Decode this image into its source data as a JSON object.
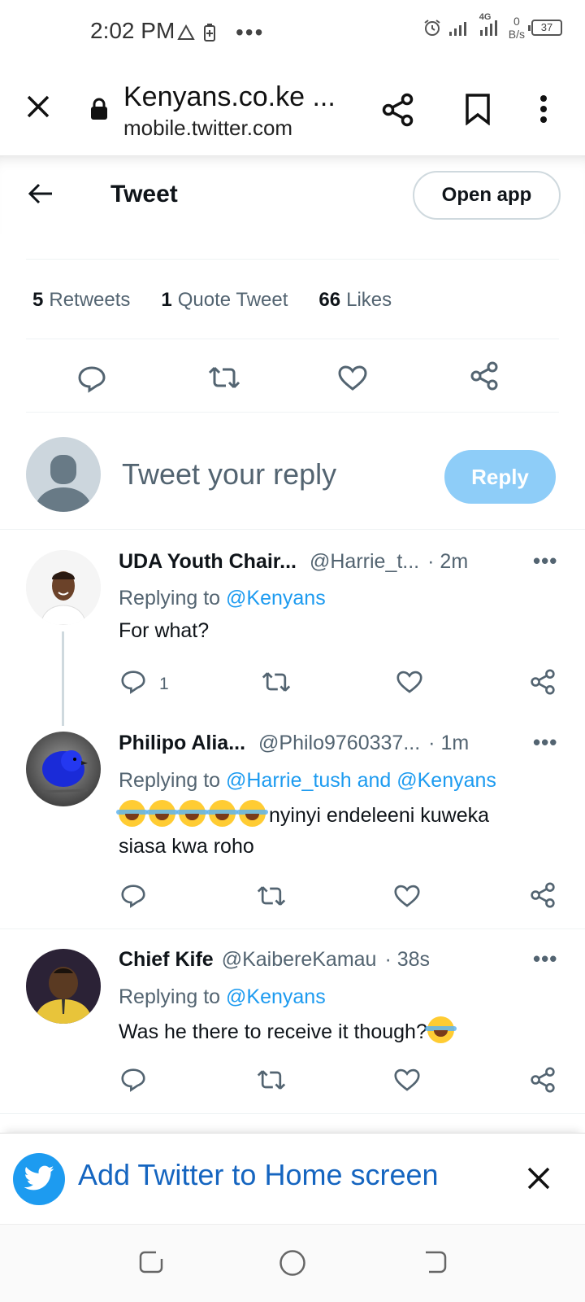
{
  "status_bar": {
    "time": "2:02 PM",
    "network": "4G",
    "net_speed_value": "0",
    "net_speed_unit": "B/s",
    "battery": "37"
  },
  "browser": {
    "page_title": "Kenyans.co.ke ...",
    "url": "mobile.twitter.com"
  },
  "header": {
    "title": "Tweet",
    "open_app_label": "Open app"
  },
  "stats": {
    "retweets_count": "5",
    "retweets_label": "Retweets",
    "quotes_count": "1",
    "quotes_label": "Quote Tweet",
    "likes_count": "66",
    "likes_label": "Likes"
  },
  "compose": {
    "placeholder": "Tweet your reply",
    "reply_label": "Reply"
  },
  "replies": [
    {
      "name": "UDA Youth Chair...",
      "handle": "@Harrie_t...",
      "time": "· 2m",
      "replying_prefix": "Replying to",
      "replying_to": "@Kenyans",
      "text": "For what?",
      "reply_count": "1"
    },
    {
      "name": "Philipo Alia...",
      "handle": "@Philo9760337...",
      "time": "· 1m",
      "replying_prefix": "Replying to",
      "replying_to": "@Harrie_tush and @Kenyans",
      "text_line1": "nyinyi endeleeni kuweka",
      "text_line2": "siasa kwa roho"
    },
    {
      "name": "Chief Kife",
      "handle": "@KaibereKamau",
      "time": "· 38s",
      "replying_prefix": "Replying to",
      "replying_to": "@Kenyans",
      "text": "Was he there to receive it though?"
    }
  ],
  "banner": {
    "text": "Add Twitter to Home screen"
  },
  "colors": {
    "twitter_blue": "#1d9bf0",
    "reply_button_disabled": "#8ecdf8",
    "secondary_text": "#536471",
    "banner_text": "#1565c0"
  }
}
